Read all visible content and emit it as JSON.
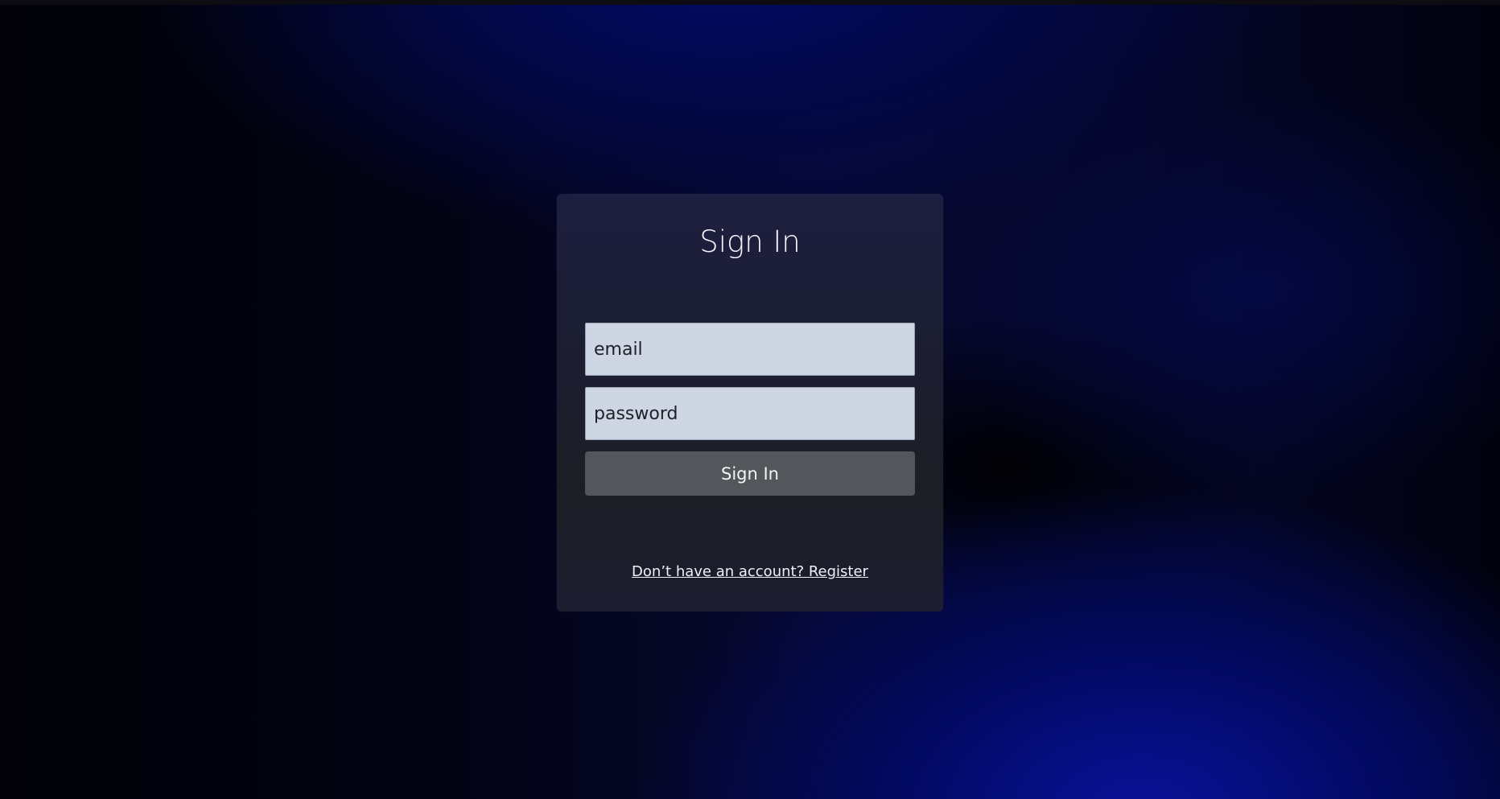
{
  "login": {
    "title": "Sign In",
    "email_placeholder": "email",
    "password_placeholder": "password",
    "submit_label": "Sign In",
    "register_link": "Don’t have an account? Register"
  }
}
